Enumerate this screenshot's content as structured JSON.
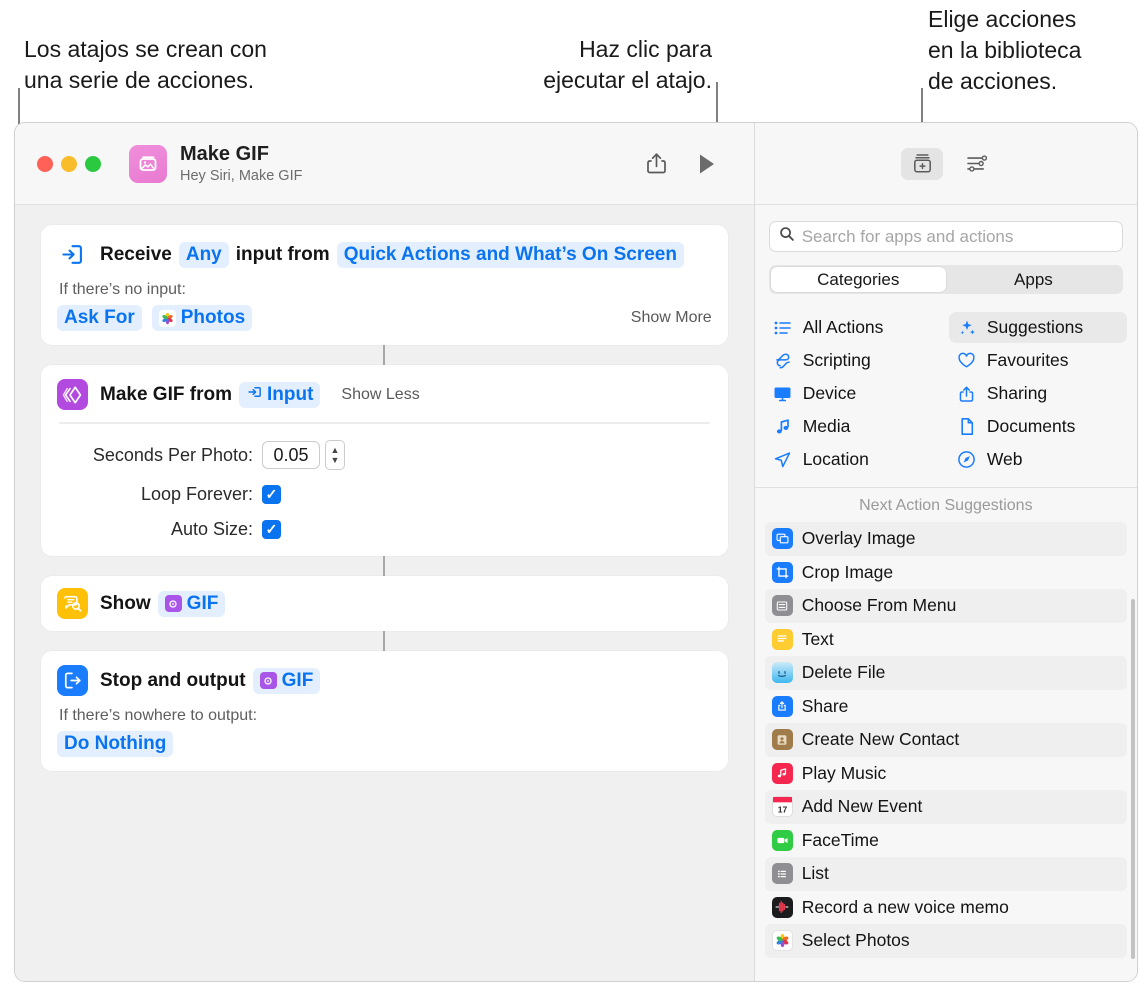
{
  "callouts": [
    {
      "id": "callout-actions-series",
      "text": "Los atajos se crean con\nuna serie de acciones."
    },
    {
      "id": "callout-run-shortcut",
      "text": "Haz clic para\nejecutar el atajo."
    },
    {
      "id": "callout-action-library",
      "text": "Elige acciones\nen la biblioteca\nde acciones."
    }
  ],
  "window": {
    "title": "Make GIF",
    "subtitle": "Hey Siri, Make GIF",
    "app_icon": "photos-stack-icon",
    "traffic_lights": [
      "close",
      "minimize",
      "maximize"
    ],
    "toolbar": {
      "share_label": "share-icon",
      "run_label": "play-icon",
      "library_label": "action-library-icon",
      "details_label": "sliders-icon"
    }
  },
  "flow": {
    "actions": [
      {
        "id": "receive-input",
        "icon": "receive-input-icon",
        "icon_style": "plain",
        "title_parts": [
          {
            "type": "text",
            "value": "Receive"
          },
          {
            "type": "pill",
            "value": "Any"
          },
          {
            "type": "text",
            "value": "input from"
          },
          {
            "type": "pill",
            "value": "Quick Actions and What’s On Screen"
          }
        ],
        "sub_label": "If there’s no input:",
        "sub_pills": [
          {
            "value": "Ask For",
            "icon": null
          },
          {
            "value": "Photos",
            "icon": "photos-icon"
          }
        ],
        "toggle": "Show More"
      },
      {
        "id": "make-gif",
        "icon": "make-gif-icon",
        "icon_style": "purple",
        "title_parts": [
          {
            "type": "text",
            "value": "Make GIF from"
          },
          {
            "type": "pill",
            "value": "Input",
            "icon": "input-variable-icon"
          }
        ],
        "toggle": "Show Less",
        "params": [
          {
            "label": "Seconds Per Photo:",
            "type": "number",
            "value": "0.05",
            "stepper": true
          },
          {
            "label": "Loop Forever:",
            "type": "checkbox",
            "value": "✓",
            "checked": true
          },
          {
            "label": "Auto Size:",
            "type": "checkbox",
            "value": "✓",
            "checked": true
          }
        ]
      },
      {
        "id": "show-gif",
        "icon": "quick-look-icon",
        "icon_style": "yellow",
        "title_parts": [
          {
            "type": "text",
            "value": "Show"
          },
          {
            "type": "pill",
            "value": "GIF",
            "icon": "gif-variable-icon"
          }
        ]
      },
      {
        "id": "stop-and-output",
        "icon": "stop-output-icon",
        "icon_style": "blue",
        "title_parts": [
          {
            "type": "text",
            "value": "Stop and output"
          },
          {
            "type": "pill",
            "value": "GIF",
            "icon": "gif-variable-icon"
          }
        ],
        "sub_label": "If there’s nowhere to output:",
        "sub_pills": [
          {
            "value": "Do Nothing",
            "icon": null
          }
        ]
      }
    ]
  },
  "sidebar": {
    "search": {
      "placeholder": "Search for apps and actions",
      "value": "",
      "icon": "search-icon"
    },
    "segments": [
      {
        "label": "Categories",
        "active": true
      },
      {
        "label": "Apps",
        "active": false
      }
    ],
    "categories": [
      {
        "label": "All Actions",
        "icon": "list-bullet-icon",
        "active": false
      },
      {
        "label": "Suggestions",
        "icon": "sparkles-icon",
        "active": true
      },
      {
        "label": "Scripting",
        "icon": "scripting-icon",
        "active": false
      },
      {
        "label": "Favourites",
        "icon": "heart-icon",
        "active": false
      },
      {
        "label": "Device",
        "icon": "display-icon",
        "active": false
      },
      {
        "label": "Sharing",
        "icon": "share-up-icon",
        "active": false
      },
      {
        "label": "Media",
        "icon": "music-note-icon",
        "active": false
      },
      {
        "label": "Documents",
        "icon": "document-icon",
        "active": false
      },
      {
        "label": "Location",
        "icon": "paper-plane-icon",
        "active": false
      },
      {
        "label": "Web",
        "icon": "safari-compass-icon",
        "active": false
      }
    ],
    "suggestions_title": "Next Action Suggestions",
    "suggestions": [
      {
        "label": "Overlay Image",
        "icon": "overlay-image-icon",
        "color": "#1a7cff"
      },
      {
        "label": "Crop Image",
        "icon": "crop-image-icon",
        "color": "#1a7cff"
      },
      {
        "label": "Choose From Menu",
        "icon": "choose-menu-icon",
        "color": "#8e8e93"
      },
      {
        "label": "Text",
        "icon": "text-icon",
        "color": "#ffcc32"
      },
      {
        "label": "Delete File",
        "icon": "finder-icon",
        "color": "#55c2f5"
      },
      {
        "label": "Share",
        "icon": "share-icon",
        "color": "#1a7cff"
      },
      {
        "label": "Create New Contact",
        "icon": "contacts-icon",
        "color": "#a07c4a"
      },
      {
        "label": "Play Music",
        "icon": "music-app-icon",
        "color": "#f5274f"
      },
      {
        "label": "Add New Event",
        "icon": "calendar-icon",
        "color": "#ffffff"
      },
      {
        "label": "FaceTime",
        "icon": "facetime-icon",
        "color": "#31cc45"
      },
      {
        "label": "List",
        "icon": "list-icon",
        "color": "#8e8e93"
      },
      {
        "label": "Record a new voice memo",
        "icon": "voice-memos-icon",
        "color": "#1c1c1e"
      },
      {
        "label": "Select Photos",
        "icon": "photos-icon",
        "color": "#ffffff"
      }
    ]
  },
  "colors": {
    "accent_blue": "#0a74f0",
    "pill_bg": "#e3efff",
    "purple": "#b24ae0",
    "yellow": "#ffc107",
    "blue": "#1a7cff"
  }
}
